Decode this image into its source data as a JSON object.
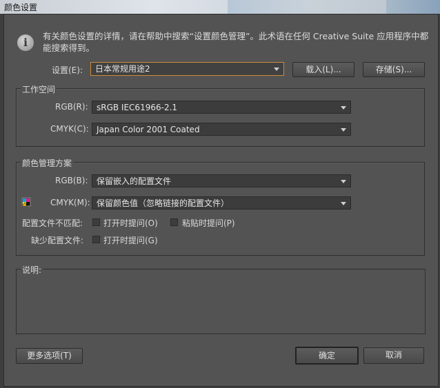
{
  "window": {
    "title": "颜色设置"
  },
  "info": {
    "text": "有关颜色设置的详情，请在帮助中搜索“设置颜色管理”。此术语在任何 Creative Suite 应用程序中都能搜索得到。",
    "icon": "info-icon"
  },
  "settings": {
    "label": "设置(E):",
    "value": "日本常规用途2",
    "load_button": "载入(L)...",
    "save_button": "存储(S)..."
  },
  "workspace": {
    "title": "工作空间",
    "rgb_label": "RGB(R):",
    "rgb_value": "sRGB IEC61966-2.1",
    "cmyk_label": "CMYK(C):",
    "cmyk_value": "Japan Color 2001 Coated"
  },
  "policies": {
    "title": "颜色管理方案",
    "rgb_label": "RGB(B):",
    "rgb_value": "保留嵌入的配置文件",
    "cmyk_label": "CMYK(M):",
    "cmyk_value": "保留颜色值（忽略链接的配置文件）",
    "mismatch_label": "配置文件不匹配:",
    "mismatch_open": "打开时提问(O)",
    "mismatch_paste": "粘贴时提问(P)",
    "missing_label": "缺少配置文件:",
    "missing_open": "打开时提问(G)"
  },
  "description": {
    "label": "说明:"
  },
  "footer": {
    "more_options": "更多选项(T)",
    "ok": "确定",
    "cancel": "取消"
  },
  "colors": {
    "dialog_bg": "#535353",
    "field_bg": "#3c3c3c",
    "focus_border": "#d08a3a"
  }
}
